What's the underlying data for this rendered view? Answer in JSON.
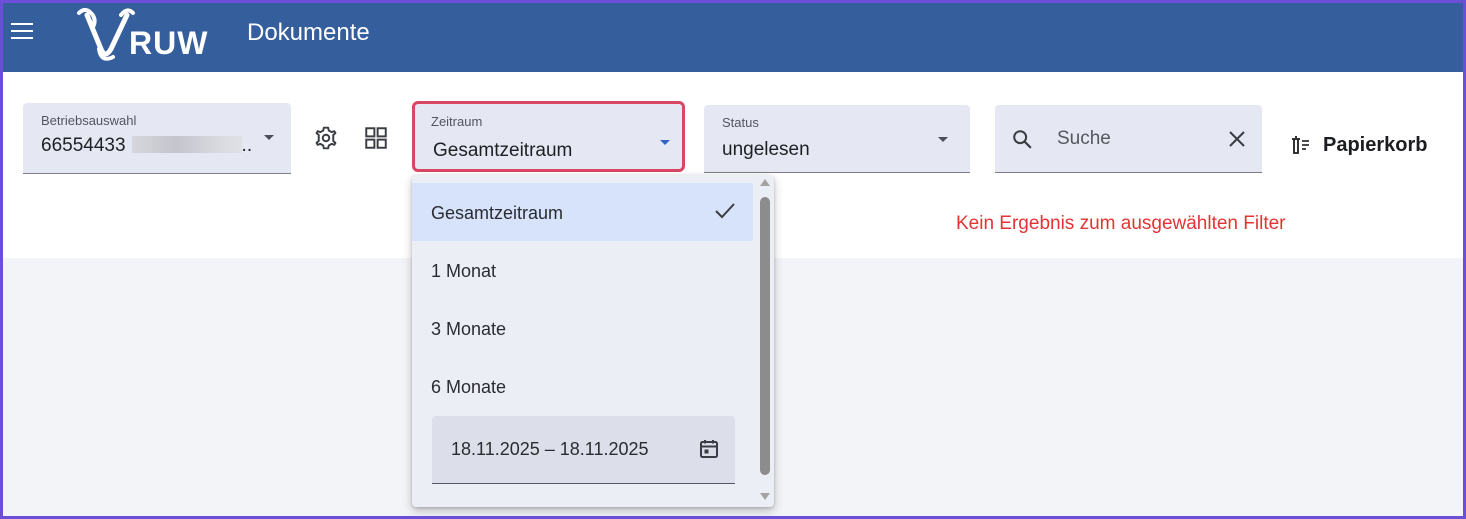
{
  "header": {
    "logo_text": "RUW",
    "title": "Dokumente",
    "background": "#355e9d"
  },
  "filters": {
    "betrieb": {
      "label": "Betriebsauswahl",
      "value": "66554433",
      "suffix": ".."
    },
    "zeitraum": {
      "label": "Zeitraum",
      "value": "Gesamtzeitraum",
      "highlight_color": "#d94763",
      "options": [
        {
          "label": "Gesamtzeitraum",
          "selected": true
        },
        {
          "label": "1 Monat",
          "selected": false
        },
        {
          "label": "3 Monate",
          "selected": false
        },
        {
          "label": "6 Monate",
          "selected": false
        }
      ],
      "date_range": "18.11.2025  – 18.11.2025"
    },
    "status": {
      "label": "Status",
      "value": "ungelesen"
    },
    "search": {
      "placeholder": "Suche"
    }
  },
  "toolbar": {
    "papierkorb_label": "Papierkorb"
  },
  "messages": {
    "no_result": "Kein Ergebnis zum ausgewählten Filter",
    "no_result_color": "#e33434"
  },
  "icons": {
    "menu": "menu-icon",
    "settings": "gear-icon",
    "view": "grid-icon",
    "search": "search-icon",
    "clear": "close-icon",
    "trash": "trash-icon",
    "check": "check-icon",
    "calendar": "calendar-icon"
  }
}
